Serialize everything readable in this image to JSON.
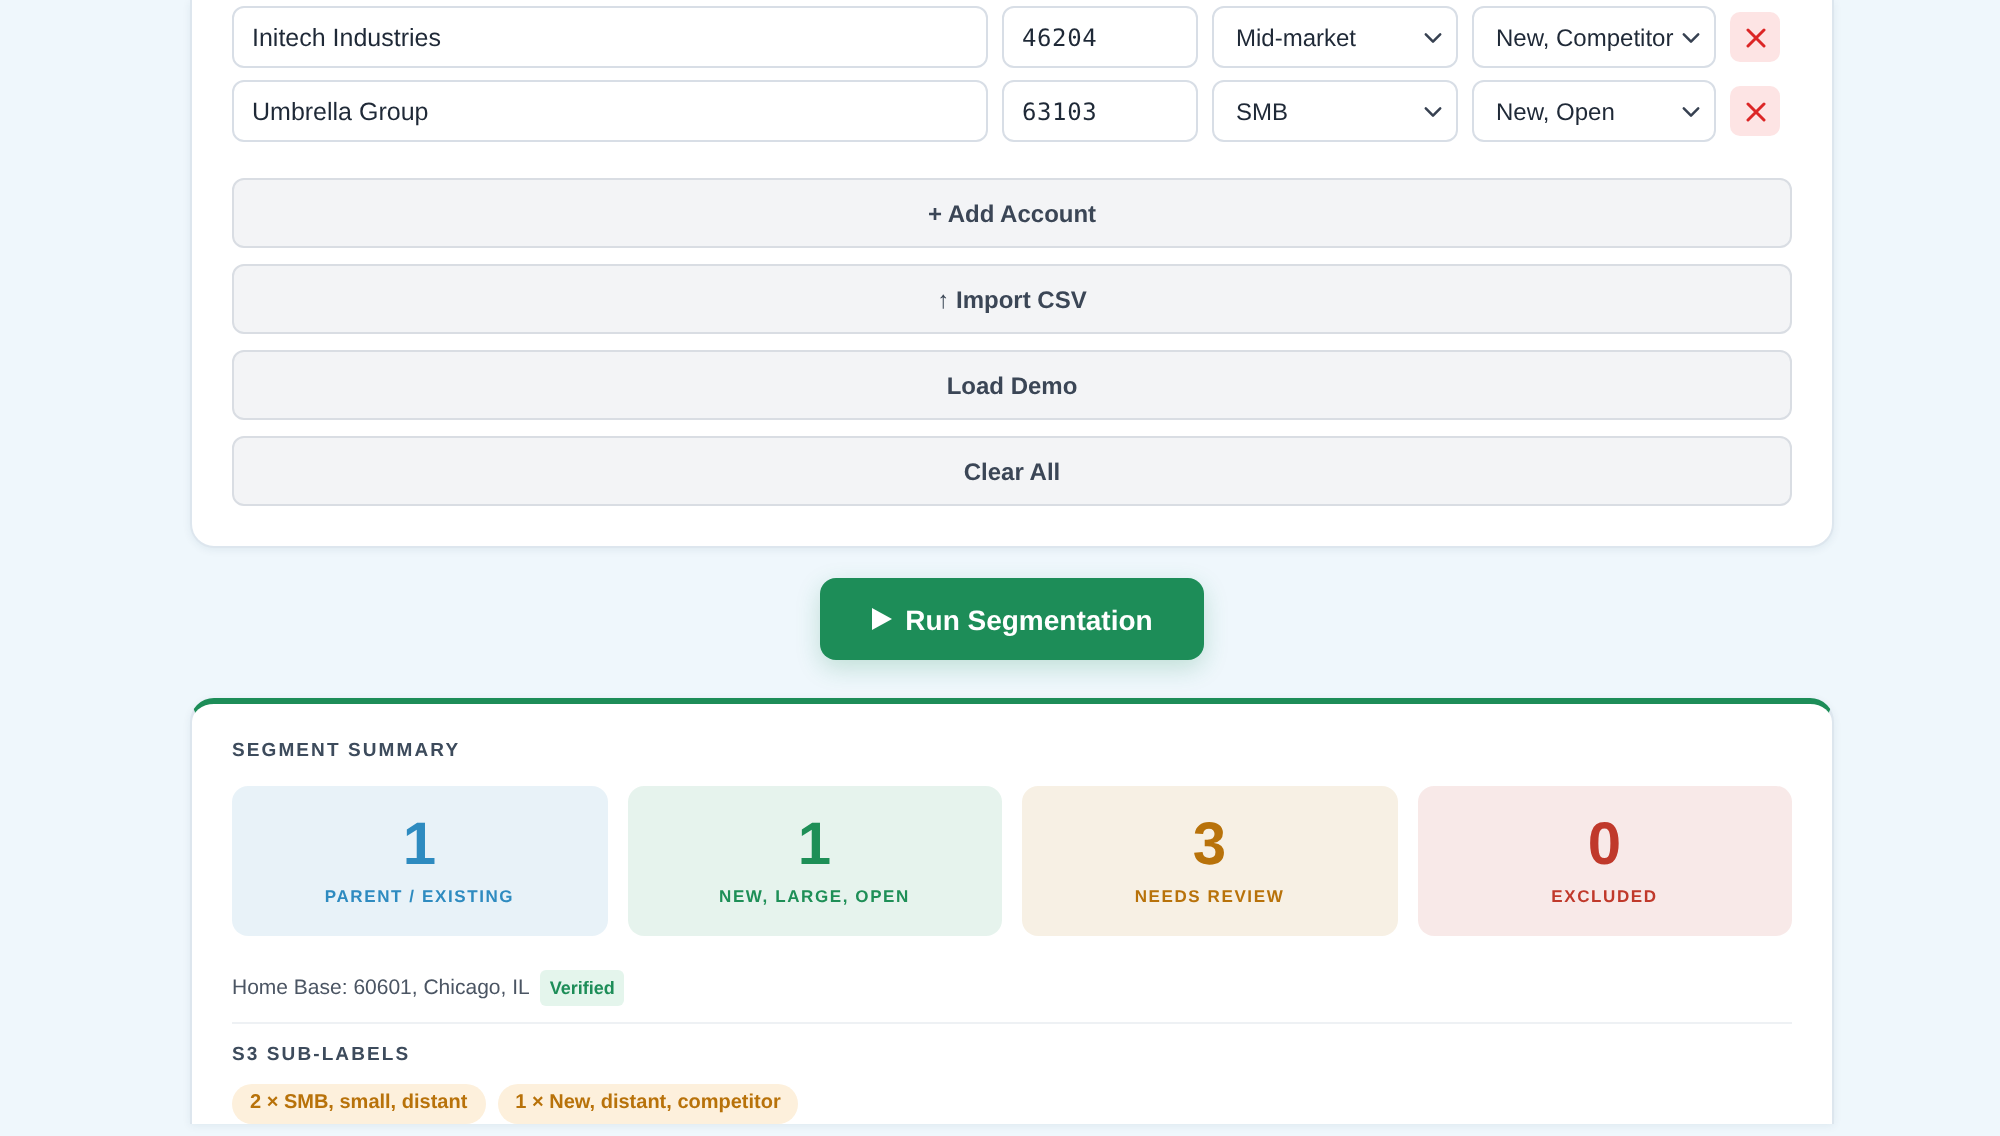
{
  "accounts": [
    {
      "company": "Initech Industries",
      "zip": "46204",
      "segment": "Mid-market",
      "status": "New, Competitor"
    },
    {
      "company": "Umbrella Group",
      "zip": "63103",
      "segment": "SMB",
      "status": "New, Open"
    }
  ],
  "actions": [
    {
      "label": "+ Add Account"
    },
    {
      "label": "↑ Import CSV"
    },
    {
      "label": "Load Demo"
    },
    {
      "label": "Clear All"
    }
  ],
  "run_button": {
    "label": "Run Segmentation"
  },
  "summary": {
    "title": "SEGMENT SUMMARY",
    "stats": [
      {
        "value": "1",
        "label": "PARENT / EXISTING",
        "color": "#2e8bc0"
      },
      {
        "value": "1",
        "label": "NEW, LARGE, OPEN",
        "color": "#1e8f57"
      },
      {
        "value": "3",
        "label": "NEEDS REVIEW",
        "color": "#b8720a"
      },
      {
        "value": "0",
        "label": "EXCLUDED",
        "color": "#c0392b"
      }
    ],
    "home_base": {
      "text": "Home Base: 60601, Chicago, IL",
      "badge": "Verified"
    },
    "sub_labels": {
      "title": "S3 SUB-LABELS",
      "chips": [
        "2 × SMB, small, distant",
        "1 × New, distant, competitor"
      ]
    }
  }
}
